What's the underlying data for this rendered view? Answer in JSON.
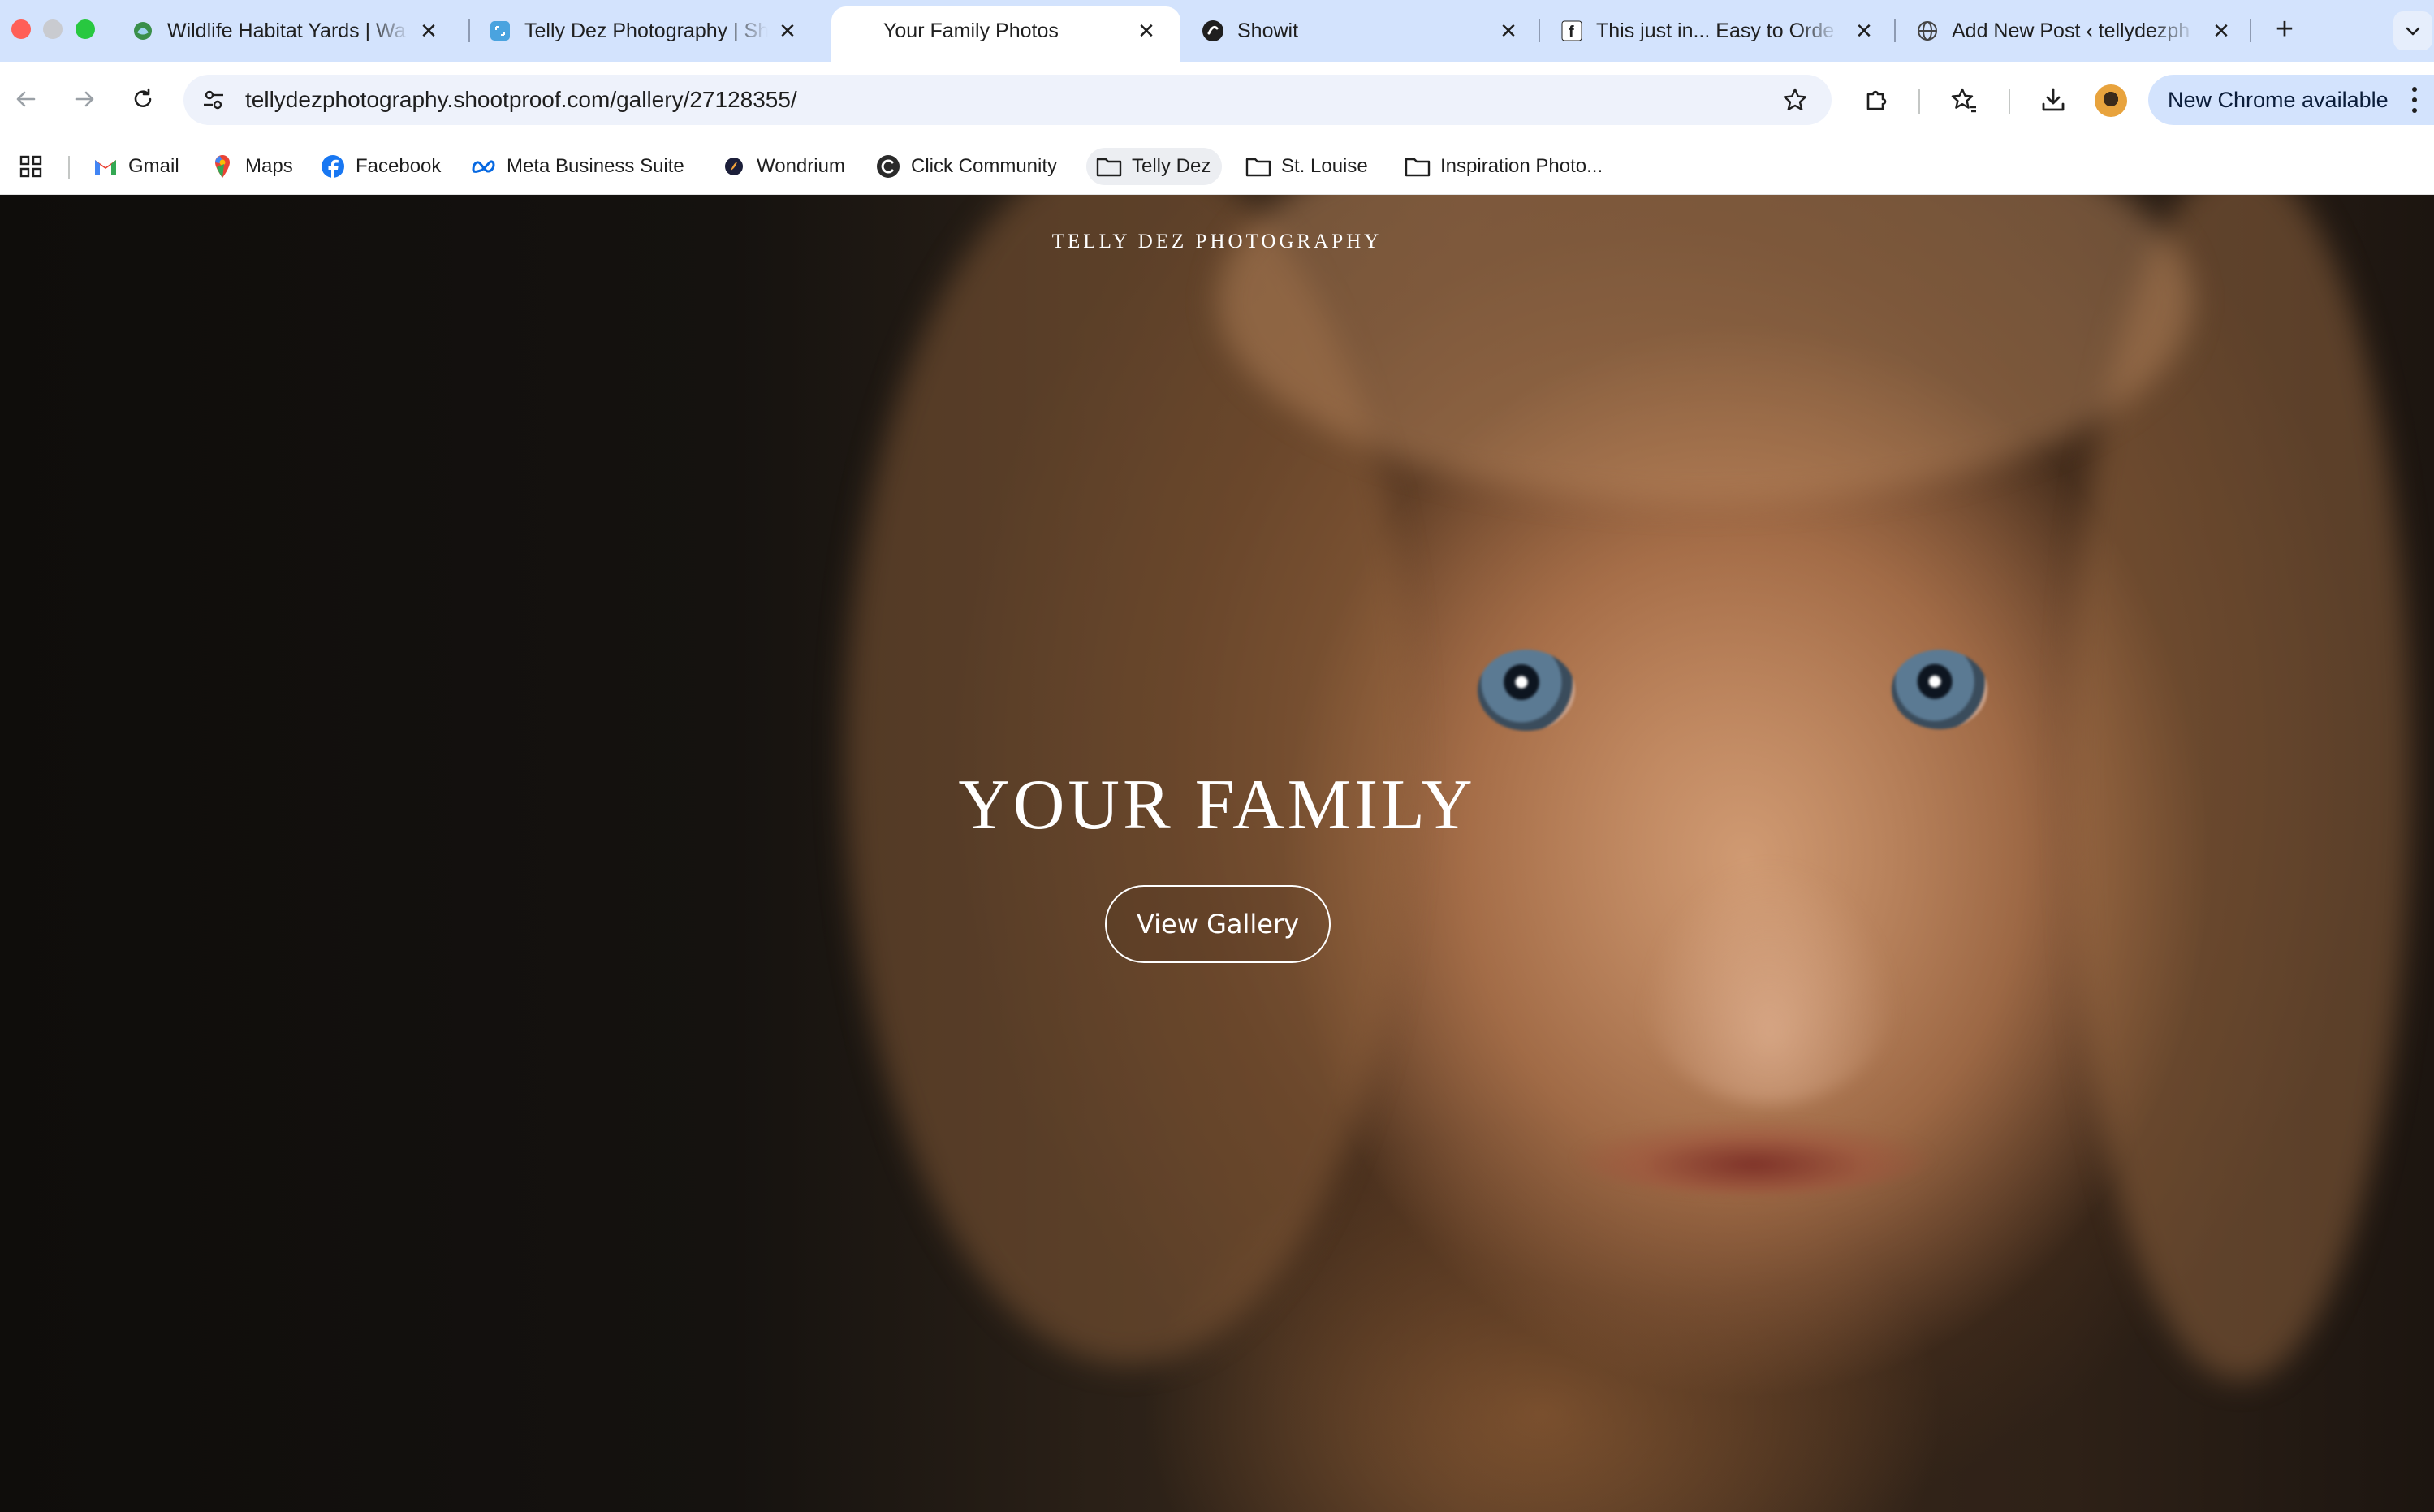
{
  "browser": {
    "tabs": [
      {
        "title": "Wildlife Habitat Yards | Wa",
        "favicon": "wildlife-favicon",
        "active": false
      },
      {
        "title": "Telly Dez Photography | Sh",
        "favicon": "shootproof-favicon",
        "active": false
      },
      {
        "title": "Your Family Photos",
        "favicon": "",
        "active": true
      },
      {
        "title": "Showit",
        "favicon": "showit-favicon",
        "active": false
      },
      {
        "title": "This just in... Easy to Orde",
        "favicon": "facebook-favicon",
        "active": false
      },
      {
        "title": "Add New Post ‹ tellydezph",
        "favicon": "globe-favicon",
        "active": false
      }
    ],
    "new_tab_label": "+",
    "url": "tellydezphotography.shootproof.com/gallery/27128355/",
    "update_button": "New Chrome available",
    "bookmarks": [
      {
        "label": "Gmail",
        "icon": "gmail-icon"
      },
      {
        "label": "Maps",
        "icon": "maps-icon"
      },
      {
        "label": "Facebook",
        "icon": "facebook-icon"
      },
      {
        "label": "Meta Business Suite",
        "icon": "meta-icon"
      },
      {
        "label": "Wondrium",
        "icon": "wondrium-icon"
      },
      {
        "label": "Click Community",
        "icon": "click-community-icon"
      },
      {
        "label": "Telly Dez",
        "icon": "folder-icon"
      },
      {
        "label": "St. Louise",
        "icon": "folder-icon"
      },
      {
        "label": "Inspiration Photo...",
        "icon": "folder-icon"
      }
    ]
  },
  "page": {
    "brand": "TELLY DEZ PHOTOGRAPHY",
    "headline": "YOUR FAMILY",
    "cta_label": "View Gallery"
  },
  "colors": {
    "tab_strip": "#d3e3fd",
    "toolbar": "#ffffff",
    "omnibox": "#eef2fb",
    "hero_dark": "#0f0d0b",
    "hero_warm": "#d49e76",
    "text_on_hero": "#ffffff"
  }
}
